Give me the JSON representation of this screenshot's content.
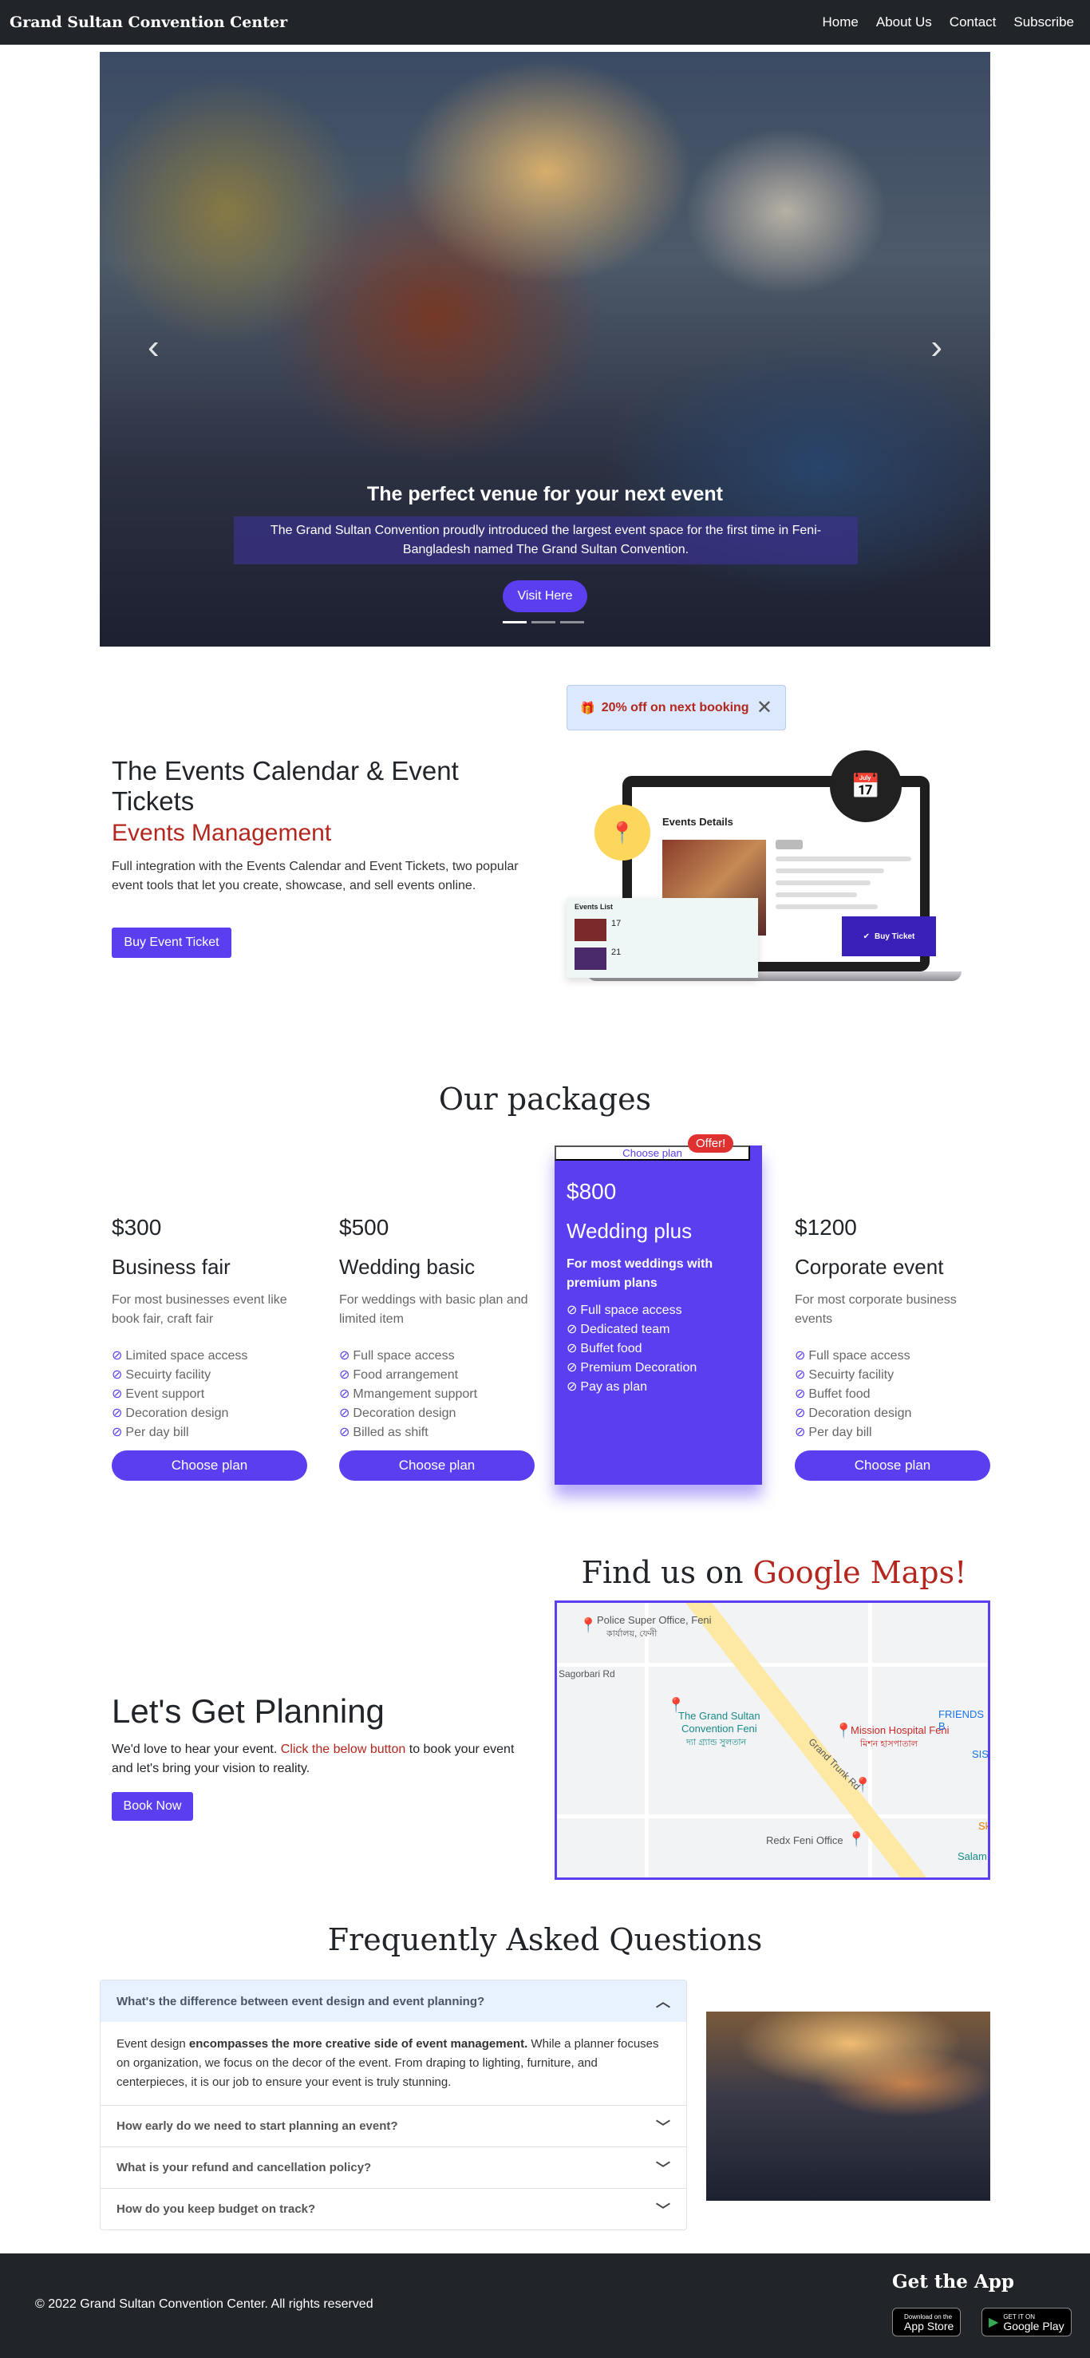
{
  "nav": {
    "brand": "Grand Sultan Convention Center",
    "links": [
      "Home",
      "About Us",
      "Contact",
      "Subscribe"
    ]
  },
  "hero": {
    "title": "The perfect venue for your next event",
    "subtitle": "The Grand Sultan Convention proudly introduced the largest event space for the first time in Feni-Bangladesh named The Grand Sultan Convention.",
    "button": "Visit Here",
    "prev_icon": "chevron-left-icon",
    "next_icon": "chevron-right-icon",
    "slides": 3,
    "active_slide": 1
  },
  "promo": {
    "text": "20% off on next booking",
    "icon": "gift-icon"
  },
  "events": {
    "title": "The Events Calendar & Event Tickets",
    "subtitle": "Events Management",
    "description": "Full integration with the Events Calendar and Event Tickets, two popular event tools that let you create, showcase, and sell events online.",
    "button": "Buy Event Ticket",
    "illustration": {
      "header": "Events Details",
      "list_title": "Events List",
      "buy_label": "Buy Ticket",
      "day1": "17",
      "day2": "21"
    }
  },
  "packages": {
    "title": "Our packages",
    "items": [
      {
        "price": "$300",
        "name": "Business fair",
        "desc": "For most businesses event like book fair, craft fair",
        "features": [
          "Limited space access",
          "Secuirty facility",
          "Event support",
          "Decoration design",
          "Per day bill"
        ],
        "button": "Choose plan"
      },
      {
        "price": "$500",
        "name": "Wedding basic",
        "desc": "For weddings with basic plan and limited item",
        "features": [
          "Full space access",
          "Food arrangement",
          "Mmangement support",
          "Decoration design",
          "Billed as shift"
        ],
        "button": "Choose plan"
      },
      {
        "price": "$800",
        "name": "Wedding plus",
        "desc": "For most weddings with premium plans",
        "badge": "Offer!",
        "features": [
          "Full space access",
          "Dedicated team",
          "Buffet food",
          "Premium Decoration",
          "Pay as plan"
        ],
        "button": "Choose plan"
      },
      {
        "price": "$1200",
        "name": "Corporate event",
        "desc": "For most corporate business events",
        "features": [
          "Full space access",
          "Secuirty facility",
          "Buffet food",
          "Decoration design",
          "Per day bill"
        ],
        "button": "Choose plan"
      }
    ]
  },
  "maps": {
    "title_prefix": "Find us on ",
    "title_highlight": "Google Maps!",
    "labels": {
      "police": "Police Super Office, Feni",
      "police_bn": "কাৰ্যালয়, ফেনী",
      "sagor": "Sagorbari Rd",
      "venue1": "The Grand Sultan",
      "venue2": "Convention Feni",
      "venue_bn": "দ্যা গ্র্যান্ড সুলতান",
      "hospital": "Mission Hospital Feni",
      "hospital_bn": "মিশন হাসপাতাল",
      "trunk": "Grand Trunk Rd",
      "friends": "FRIENDS B",
      "sis": "SIS",
      "redx": "Redx Feni Office",
      "salam": "Salam",
      "sk": "Sk"
    }
  },
  "planning": {
    "title": "Let's Get Planning",
    "desc_before": "We'd love to hear your event. ",
    "desc_link": "Click the below button",
    "desc_after": " to book your event and let's bring your vision to reality.",
    "button": "Book Now"
  },
  "faq": {
    "title": "Frequently Asked Questions",
    "items": [
      {
        "q": "What's the difference between event design and event planning?",
        "open": true
      },
      {
        "q": "How early do we need to start planning an event?",
        "open": false
      },
      {
        "q": "What is your refund and cancellation policy?",
        "open": false
      },
      {
        "q": "How do you keep budget on track?",
        "open": false
      }
    ],
    "answer_start": "Event design ",
    "answer_bold": "encompasses the more creative side of event management.",
    "answer_rest": " While a planner focuses on organization, we focus on the decor of the event. From draping to lighting, furniture, and centerpieces, it is our job to ensure your event is truly stunning."
  },
  "footer": {
    "copyright": "© 2022 Grand Sultan Convention Center. All rights reserved",
    "get_app": "Get the App",
    "appstore_small": "Download on the",
    "appstore_big": "App Store",
    "play_small": "GET IT ON",
    "play_big": "Google Play"
  },
  "colors": {
    "accent": "#5b3ef0",
    "brand_red": "#b3271e",
    "dark": "#212529"
  }
}
